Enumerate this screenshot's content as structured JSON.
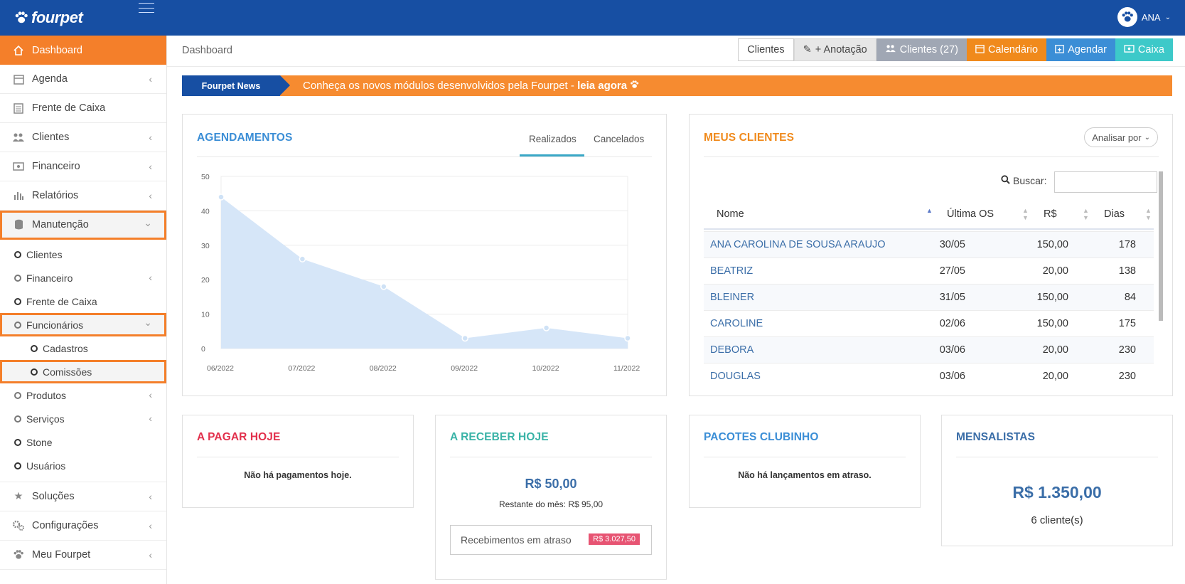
{
  "app": {
    "brand": "fourpet",
    "user": "ANA"
  },
  "sidebar": {
    "dashboard": "Dashboard",
    "agenda": "Agenda",
    "frente": "Frente de Caixa",
    "clientes": "Clientes",
    "financeiro": "Financeiro",
    "relatorios": "Relatórios",
    "manutencao": "Manutenção",
    "sub_clientes": "Clientes",
    "sub_financeiro": "Financeiro",
    "sub_frente": "Frente de Caixa",
    "sub_funcionarios": "Funcionários",
    "sub2_cadastros": "Cadastros",
    "sub2_comissoes": "Comissões",
    "sub_produtos": "Produtos",
    "sub_servicos": "Serviços",
    "sub_stone": "Stone",
    "sub_usuarios": "Usuários",
    "soluções": "Soluções",
    "configuracoes": "Configurações",
    "meu": "Meu Fourpet"
  },
  "header": {
    "breadcrumb": "Dashboard",
    "btn_clientes": "Clientes",
    "btn_anotacao": "+ Anotação",
    "btn_clientes27": "Clientes (27)",
    "btn_calendario": "Calendário",
    "btn_agendar": "Agendar",
    "btn_caixa": "Caixa"
  },
  "news": {
    "tag": "Fourpet News",
    "msg": "Conheça os novos módulos desenvolvidos pela Fourpet - ",
    "link": "leia agora"
  },
  "agendamentos": {
    "title": "AGENDAMENTOS",
    "tab1": "Realizados",
    "tab2": "Cancelados"
  },
  "chart_data": {
    "type": "area",
    "categories": [
      "06/2022",
      "07/2022",
      "08/2022",
      "09/2022",
      "10/2022",
      "11/2022"
    ],
    "values": [
      44,
      26,
      18,
      3,
      6,
      3
    ],
    "ylim": [
      0,
      50
    ],
    "yticks": [
      0,
      10,
      20,
      30,
      40,
      50
    ],
    "color": "#d6e6f8",
    "point_color": "#cfe2f6"
  },
  "clientes": {
    "title": "MEUS CLIENTES",
    "analisar": "Analisar por",
    "buscar": "Buscar:",
    "col_nome": "Nome",
    "col_os": "Última OS",
    "col_rs": "R$",
    "col_dias": "Dias",
    "rows": [
      {
        "nome": "ANA CAROLINA DE SOUSA ARAUJO",
        "os": "30/05",
        "rs": "150,00",
        "dias": "178"
      },
      {
        "nome": "BEATRIZ",
        "os": "27/05",
        "rs": "20,00",
        "dias": "138"
      },
      {
        "nome": "BLEINER",
        "os": "31/05",
        "rs": "150,00",
        "dias": "84"
      },
      {
        "nome": "CAROLINE",
        "os": "02/06",
        "rs": "150,00",
        "dias": "175"
      },
      {
        "nome": "DEBORA",
        "os": "03/06",
        "rs": "20,00",
        "dias": "230"
      },
      {
        "nome": "DOUGLAS",
        "os": "03/06",
        "rs": "20,00",
        "dias": "230"
      }
    ]
  },
  "pagar": {
    "title": "A PAGAR HOJE",
    "msg": "Não há pagamentos hoje."
  },
  "receber": {
    "title": "A RECEBER HOJE",
    "valor": "R$ 50,00",
    "restante": "Restante do mês: R$ 95,00",
    "atraso_label": "Recebimentos em atraso",
    "atraso_valor": "R$ 3.027,50"
  },
  "pacotes": {
    "title": "PACOTES CLUBINHO",
    "msg": "Não há lançamentos em atraso."
  },
  "mensalistas": {
    "title": "MENSALISTAS",
    "valor": "R$ 1.350,00",
    "clientes": "6 cliente(s)"
  }
}
